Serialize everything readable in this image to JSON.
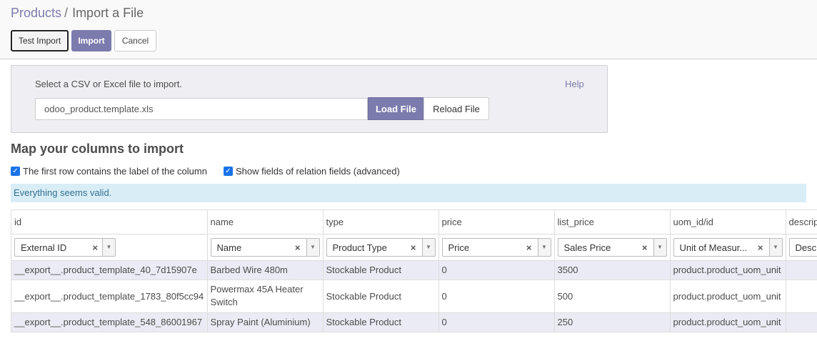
{
  "breadcrumb": {
    "parent": "Products",
    "separator": "/",
    "current": "Import a File"
  },
  "toolbar": {
    "test_import_label": "Test Import",
    "import_label": "Import",
    "cancel_label": "Cancel"
  },
  "file_panel": {
    "select_label": "Select a CSV or Excel file to import.",
    "help_label": "Help",
    "file_name": "odoo_product.template.xls",
    "load_label": "Load File",
    "reload_label": "Reload File"
  },
  "mapping": {
    "title": "Map your columns to import",
    "option_header_label": "The first row contains the label of the column",
    "option_header_checked": true,
    "option_relation_label": "Show fields of relation fields (advanced)",
    "option_relation_checked": true,
    "status_message": "Everything seems valid."
  },
  "table": {
    "columns": [
      {
        "header": "id",
        "field": "External ID"
      },
      {
        "header": "name",
        "field": "Name"
      },
      {
        "header": "type",
        "field": "Product Type"
      },
      {
        "header": "price",
        "field": "Price"
      },
      {
        "header": "list_price",
        "field": "Sales Price"
      },
      {
        "header": "uom_id/id",
        "field": "Unit of Measur..."
      },
      {
        "header": "descrip",
        "field": "Desc"
      }
    ],
    "rows": [
      [
        "__export__.product_template_40_7d15907e",
        "Barbed Wire 480m",
        "Stockable Product",
        "0",
        "3500",
        "product.product_uom_unit",
        ""
      ],
      [
        "__export__.product_template_1783_80f5cc94",
        "Powermax 45A Heater Switch",
        "Stockable Product",
        "0",
        "500",
        "product.product_uom_unit",
        ""
      ],
      [
        "__export__.product_template_548_86001967",
        "Spray Paint (Aluminium)",
        "Stockable Product",
        "0",
        "250",
        "product.product_uom_unit",
        ""
      ]
    ]
  },
  "icons": {
    "clear": "clear-icon",
    "dropdown": "chevron-down-icon",
    "check": "checkbox-checked-icon"
  },
  "colors": {
    "primary": "#7c7bad",
    "alert_bg": "#d9edf7",
    "alert_text": "#31708f",
    "row_highlight": "#ebebf5"
  }
}
